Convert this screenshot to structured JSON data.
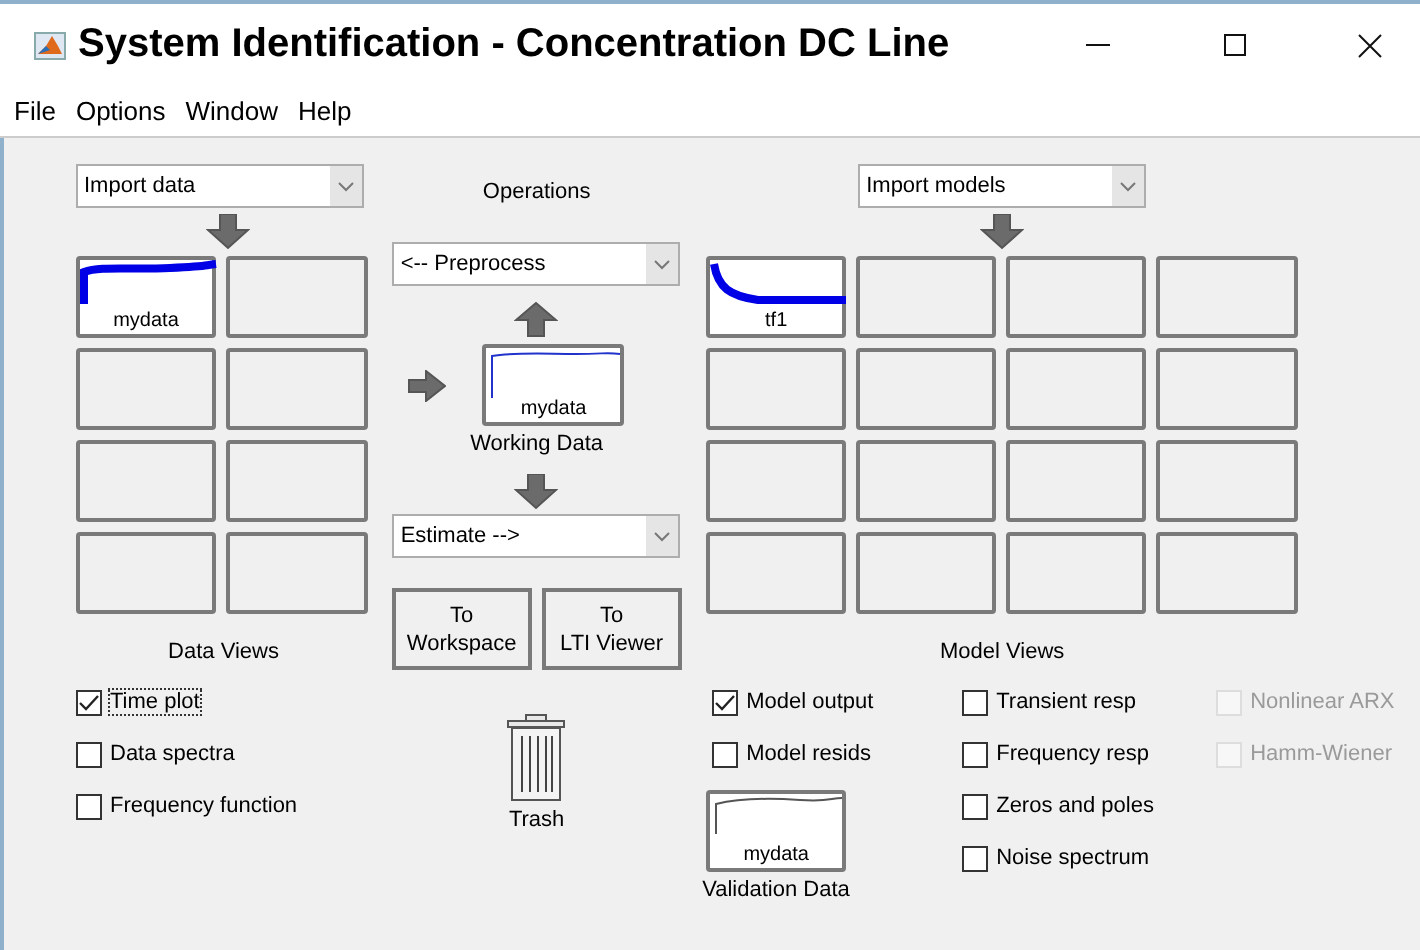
{
  "window": {
    "title": "System Identification - Concentration DC Line"
  },
  "menu": [
    "File",
    "Options",
    "Window",
    "Help"
  ],
  "data_panel": {
    "import": {
      "value": "Import data"
    },
    "tiles": [
      {
        "kind": "data",
        "label": "mydata"
      },
      {
        "kind": "empty"
      },
      {
        "kind": "empty"
      },
      {
        "kind": "empty"
      },
      {
        "kind": "empty"
      },
      {
        "kind": "empty"
      },
      {
        "kind": "empty"
      },
      {
        "kind": "empty"
      }
    ],
    "views_label": "Data Views",
    "views": [
      {
        "label": "Time plot",
        "checked": true,
        "focused": true
      },
      {
        "label": "Data spectra",
        "checked": false,
        "focused": false
      },
      {
        "label": "Frequency function",
        "checked": false,
        "focused": false
      }
    ]
  },
  "operations": {
    "label": "Operations",
    "preprocess": {
      "value": "<-- Preprocess"
    },
    "working_data": {
      "label": "mydata",
      "caption": "Working Data"
    },
    "estimate": {
      "value": "Estimate -->"
    },
    "buttons": [
      {
        "line1": "To",
        "line2": "Workspace"
      },
      {
        "line1": "To",
        "line2": "LTI Viewer"
      }
    ],
    "trash": {
      "label": "Trash"
    }
  },
  "model_panel": {
    "import": {
      "value": "Import models"
    },
    "tiles": [
      {
        "kind": "model",
        "label": "tf1"
      },
      {
        "kind": "empty"
      },
      {
        "kind": "empty"
      },
      {
        "kind": "empty"
      },
      {
        "kind": "empty"
      },
      {
        "kind": "empty"
      },
      {
        "kind": "empty"
      },
      {
        "kind": "empty"
      },
      {
        "kind": "empty"
      },
      {
        "kind": "empty"
      },
      {
        "kind": "empty"
      },
      {
        "kind": "empty"
      },
      {
        "kind": "empty"
      },
      {
        "kind": "empty"
      },
      {
        "kind": "empty"
      },
      {
        "kind": "empty"
      }
    ],
    "views_label": "Model Views",
    "views_col1": [
      {
        "label": "Model output",
        "checked": true,
        "disabled": false
      },
      {
        "label": "Model resids",
        "checked": false,
        "disabled": false
      }
    ],
    "validation_data": {
      "label": "mydata",
      "caption": "Validation Data"
    },
    "views_col2": [
      {
        "label": "Transient resp",
        "checked": false,
        "disabled": false
      },
      {
        "label": "Frequency resp",
        "checked": false,
        "disabled": false
      },
      {
        "label": "Zeros and poles",
        "checked": false,
        "disabled": false
      },
      {
        "label": "Noise spectrum",
        "checked": false,
        "disabled": false
      }
    ],
    "views_col3": [
      {
        "label": "Nonlinear ARX",
        "checked": false,
        "disabled": true
      },
      {
        "label": "Hamm-Wiener",
        "checked": false,
        "disabled": true
      }
    ]
  }
}
